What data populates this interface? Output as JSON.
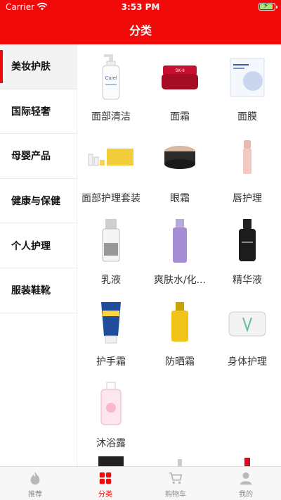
{
  "status_bar": {
    "carrier": "Carrier",
    "time": "3:53 PM"
  },
  "nav": {
    "title": "分类"
  },
  "sidebar": {
    "active_index": 0,
    "items": [
      {
        "label": "美妆护肤"
      },
      {
        "label": "国际轻奢"
      },
      {
        "label": "母婴产品"
      },
      {
        "label": "健康与保健"
      },
      {
        "label": "个人护理"
      },
      {
        "label": "服装鞋靴"
      }
    ]
  },
  "categories": [
    {
      "label": "面部清洁",
      "icon": "pump-bottle"
    },
    {
      "label": "面霜",
      "icon": "cream-jar-red"
    },
    {
      "label": "面膜",
      "icon": "mask-box"
    },
    {
      "label": "面部护理套装",
      "icon": "gift-set"
    },
    {
      "label": "眼霜",
      "icon": "eye-cream-jar"
    },
    {
      "label": "唇护理",
      "icon": "lip-tube"
    },
    {
      "label": "乳液",
      "icon": "lotion-bottle"
    },
    {
      "label": "爽肤水/化...",
      "icon": "toner-bottle"
    },
    {
      "label": "精华液",
      "icon": "serum-bottle"
    },
    {
      "label": "护手霜",
      "icon": "hand-cream-tube"
    },
    {
      "label": "防晒霜",
      "icon": "sunscreen-bottle"
    },
    {
      "label": "身体护理",
      "icon": "body-cream-jar"
    },
    {
      "label": "沐浴露",
      "icon": "shower-gel-bottle"
    }
  ],
  "tabbar": {
    "active_index": 1,
    "tabs": [
      {
        "label": "推荐",
        "icon": "flame-icon"
      },
      {
        "label": "分类",
        "icon": "grid-icon"
      },
      {
        "label": "购物车",
        "icon": "cart-icon"
      },
      {
        "label": "我的",
        "icon": "person-icon"
      }
    ]
  },
  "colors": {
    "brand_red": "#f00a0a",
    "inactive_gray": "#8a8a8a"
  }
}
